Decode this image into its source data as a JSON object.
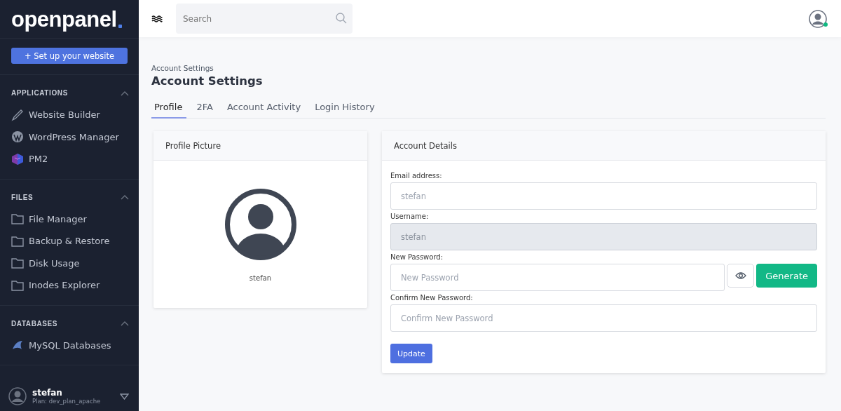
{
  "sidebar": {
    "logo": "openpanel",
    "setup_button": "+ Set up your website",
    "sections": [
      {
        "title": "APPLICATIONS",
        "expanded": true,
        "items": [
          "Website Builder",
          "WordPress Manager",
          "PM2"
        ]
      },
      {
        "title": "FILES",
        "expanded": true,
        "items": [
          "File Manager",
          "Backup & Restore",
          "Disk Usage",
          "Inodes Explorer"
        ]
      },
      {
        "title": "DATABASES",
        "expanded": true,
        "items": [
          "MySQL Databases"
        ]
      }
    ],
    "user": {
      "name": "stefan",
      "plan": "Plan: dev_plan_apache"
    }
  },
  "header": {
    "search": {
      "placeholder": "Search"
    },
    "online": true
  },
  "breadcrumb": "Account Settings",
  "title": "Account Settings",
  "tabs": [
    {
      "label": "Profile",
      "selected": true
    },
    {
      "label": "2FA",
      "selected": false
    },
    {
      "label": "Account Activity",
      "selected": false
    },
    {
      "label": "Login History",
      "selected": false
    }
  ],
  "profile_card": {
    "title": "Profile Picture",
    "username": "stefan"
  },
  "account_card": {
    "title": "Account Details",
    "fields": [
      {
        "kind": "text",
        "label": "Email address:",
        "value": "stefan",
        "disabled": false
      },
      {
        "kind": "text",
        "label": "Username:",
        "value": "stefan",
        "disabled": true
      },
      {
        "kind": "password",
        "label": "New Password:",
        "placeholder": "New Password",
        "generate_button": "Generate"
      },
      {
        "kind": "text",
        "label": "Confirm New Password:",
        "placeholder": "Confirm New Password"
      }
    ],
    "update_button": "Update"
  }
}
